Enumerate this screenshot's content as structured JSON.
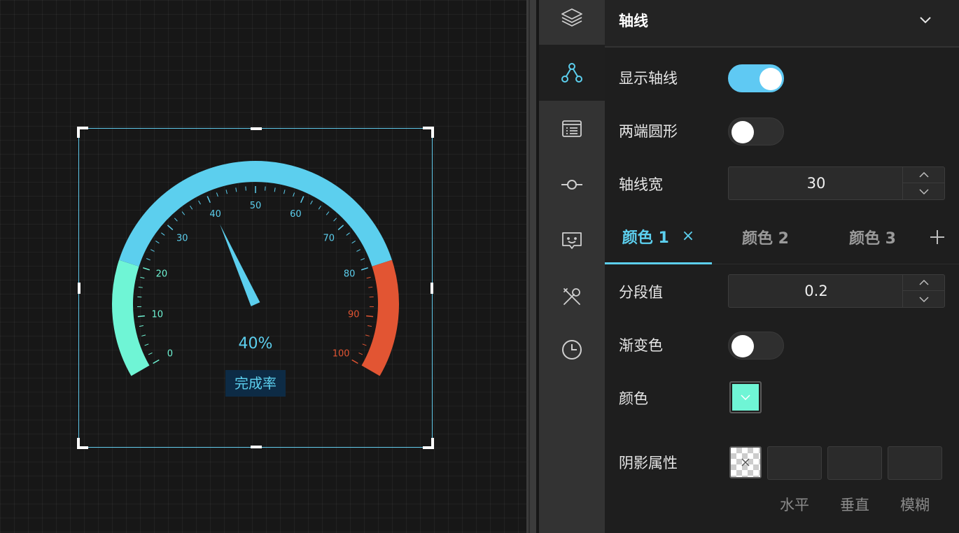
{
  "canvas": {
    "gauge": {
      "value_text": "40%",
      "label": "完成率",
      "tick_labels": [
        "0",
        "10",
        "20",
        "30",
        "40",
        "50",
        "60",
        "70",
        "80",
        "90",
        "100"
      ],
      "pointer_value": 40,
      "min": 0,
      "max": 100,
      "segments": [
        {
          "from": 0,
          "to": 20,
          "color": "#6ff5d5"
        },
        {
          "from": 20,
          "to": 80,
          "color": "#5ccfee"
        },
        {
          "from": 80,
          "to": 100,
          "color": "#e25533"
        }
      ]
    }
  },
  "rail": {
    "items": [
      {
        "icon": "layers-icon",
        "active": false
      },
      {
        "icon": "nodes-icon",
        "active": true
      },
      {
        "icon": "list-icon",
        "active": false
      },
      {
        "icon": "commit-icon",
        "active": false
      },
      {
        "icon": "chat-face-icon",
        "active": false
      },
      {
        "icon": "tools-icon",
        "active": false
      },
      {
        "icon": "clock-icon",
        "active": false
      }
    ]
  },
  "panel": {
    "title": "轴线",
    "show_axis": {
      "label": "显示轴线",
      "on": true
    },
    "round_ends": {
      "label": "两端圆形",
      "on": false
    },
    "axis_width": {
      "label": "轴线宽",
      "value": "30"
    },
    "tabs": [
      {
        "label": "颜色 1",
        "active": true,
        "close": "×"
      },
      {
        "label": "颜色 2",
        "active": false
      },
      {
        "label": "颜色 3",
        "active": false
      }
    ],
    "segment_value": {
      "label": "分段值",
      "value": "0.2"
    },
    "gradient": {
      "label": "渐变色",
      "on": false
    },
    "color": {
      "label": "颜色",
      "value": "#6ff5d5"
    },
    "shadow": {
      "label": "阴影属性",
      "captions": [
        "水平",
        "垂直",
        "模糊"
      ]
    }
  }
}
